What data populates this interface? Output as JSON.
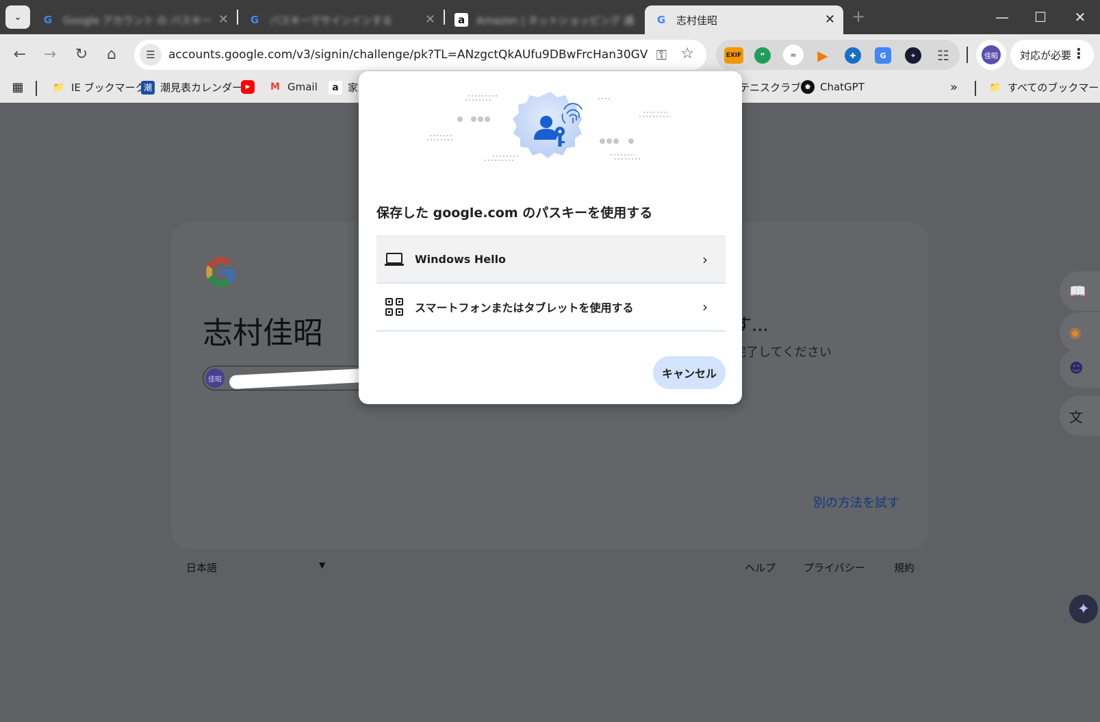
{
  "tabs": [
    {
      "title": "Google アカウント の パスキー",
      "favicon": "G"
    },
    {
      "title": "パスキーでサインインする",
      "favicon": "G"
    },
    {
      "title": "Amazon | ネットショッピング 通販",
      "favicon": "a"
    },
    {
      "title": "志村佳昭",
      "favicon": "G"
    }
  ],
  "toolbar": {
    "url": "accounts.google.com/v3/signin/challenge/pk?TL=ANzgctQkAUfu9DBwFrcHan30GV6YFR...",
    "ext_exif": "EXIF",
    "profile_initials": "佳昭",
    "update_label": "対応が必要"
  },
  "bookmarks": {
    "items": [
      {
        "label": "IE ブックマーク"
      },
      {
        "label": "潮見表カレンダー",
        "icon_char": "潮"
      },
      {
        "label": "Gmail"
      },
      {
        "label": "家"
      },
      {
        "label": "テニスクラブ"
      },
      {
        "label": "ChatGPT"
      }
    ],
    "all_bookmarks": "すべてのブックマーク"
  },
  "page": {
    "account_name": "志村佳昭",
    "chip_initials": "佳昭",
    "wait_title": "す...",
    "wait_subtitle": "完了してください",
    "try_another": "別の方法を試す",
    "language": "日本語",
    "footer": {
      "help": "ヘルプ",
      "privacy": "プライバシー",
      "terms": "規約"
    }
  },
  "dialog": {
    "title": "保存した google.com のパスキーを使用する",
    "options": [
      {
        "label": "Windows Hello"
      },
      {
        "label": "スマートフォンまたはタブレットを使用する"
      }
    ],
    "cancel_label": "キャンセル"
  },
  "colors": {
    "accent": "#1a73e8",
    "cancel_bg": "#d3e3fd",
    "link": "#0b3a82"
  }
}
